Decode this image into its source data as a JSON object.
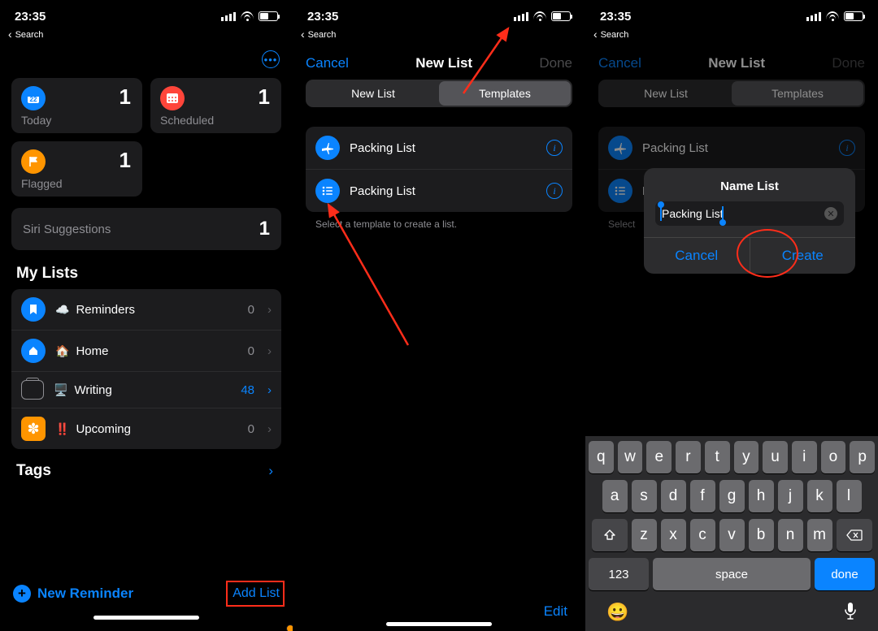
{
  "status": {
    "time": "23:35",
    "back": "Search"
  },
  "p1": {
    "cards": {
      "today": {
        "label": "Today",
        "count": "1"
      },
      "scheduled": {
        "label": "Scheduled",
        "count": "1"
      },
      "flagged": {
        "label": "Flagged",
        "count": "1"
      }
    },
    "siri": {
      "label": "Siri Suggestions",
      "count": "1"
    },
    "mylists_h": "My Lists",
    "lists": [
      {
        "emoji": "☁️",
        "name": "Reminders",
        "count": "0"
      },
      {
        "emoji": "🏠",
        "name": "Home",
        "count": "0"
      },
      {
        "emoji": "🖥️",
        "name": "Writing",
        "count": "48"
      },
      {
        "emoji": "‼️",
        "name": "Upcoming",
        "count": "0"
      }
    ],
    "tags_h": "Tags",
    "new_reminder": "New Reminder",
    "add_list": "Add List"
  },
  "p2": {
    "cancel": "Cancel",
    "title": "New List",
    "done": "Done",
    "seg_new": "New List",
    "seg_tmpl": "Templates",
    "templates": [
      {
        "name": "Packing List"
      },
      {
        "name": "Packing List"
      }
    ],
    "hint": "Select a template to create a list.",
    "edit": "Edit"
  },
  "p3": {
    "cancel": "Cancel",
    "title": "New List",
    "done": "Done",
    "seg_new": "New List",
    "seg_tmpl": "Templates",
    "templates": [
      {
        "name": "Packing List"
      },
      {
        "name": "Packing List"
      }
    ],
    "hint_prefix": "Select",
    "popup": {
      "title": "Name List",
      "value": "Packing List",
      "cancel": "Cancel",
      "create": "Create"
    },
    "kbd": {
      "r1": [
        "q",
        "w",
        "e",
        "r",
        "t",
        "y",
        "u",
        "i",
        "o",
        "p"
      ],
      "r2": [
        "a",
        "s",
        "d",
        "f",
        "g",
        "h",
        "j",
        "k",
        "l"
      ],
      "r3": [
        "z",
        "x",
        "c",
        "v",
        "b",
        "n",
        "m"
      ],
      "k123": "123",
      "space": "space",
      "done": "done"
    }
  }
}
